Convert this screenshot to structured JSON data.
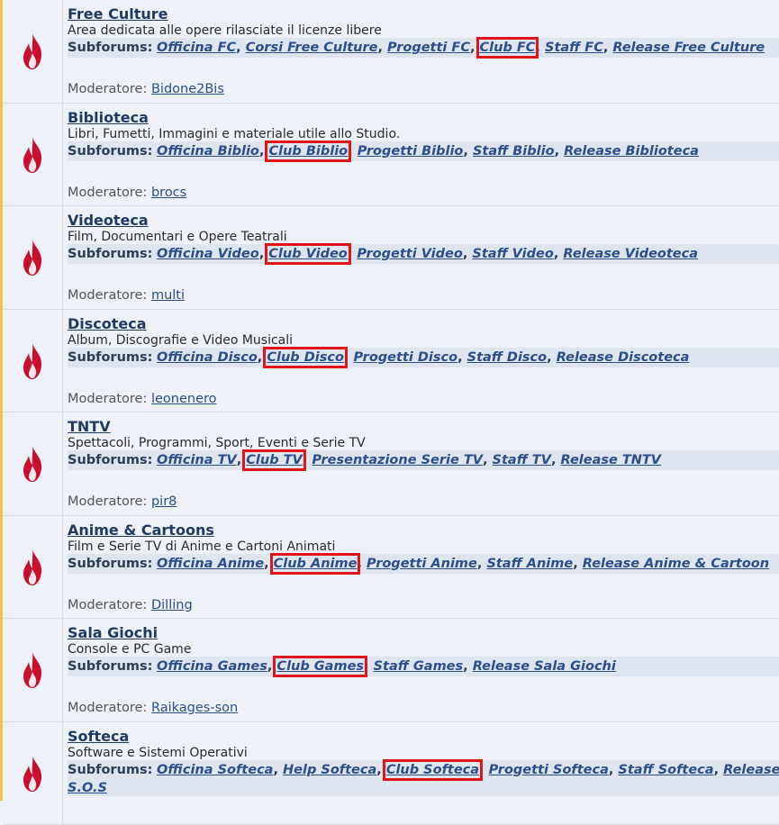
{
  "forums": [
    {
      "title": "Free Culture",
      "description": "Area dedicata alle opere rilasciate il licenze libere",
      "subforums_label": "Subforums:",
      "subforums": [
        "Officina FC",
        "Corsi Free Culture",
        "Progetti FC",
        "Club FC",
        "Staff FC",
        "Release Free Culture"
      ],
      "highlighted": "Club FC",
      "moderator_label": "Moderatore:",
      "moderator": "Bidone2Bis"
    },
    {
      "title": "Biblioteca",
      "description": "Libri, Fumetti, Immagini e materiale utile allo Studio.",
      "subforums_label": "Subforums:",
      "subforums": [
        "Officina Biblio",
        "Club Biblio",
        "Progetti Biblio",
        "Staff Biblio",
        "Release Biblioteca"
      ],
      "highlighted": "Club Biblio",
      "moderator_label": "Moderatore:",
      "moderator": "brocs"
    },
    {
      "title": "Videoteca",
      "description": "Film, Documentari e Opere Teatrali",
      "subforums_label": "Subforums:",
      "subforums": [
        "Officina Video",
        "Club Video",
        "Progetti Video",
        "Staff Video",
        "Release Videoteca"
      ],
      "highlighted": "Club Video",
      "moderator_label": "Moderatore:",
      "moderator": "multi"
    },
    {
      "title": "Discoteca",
      "description": "Album, Discografie e Video Musicali",
      "subforums_label": "Subforums:",
      "subforums": [
        "Officina Disco",
        "Club Disco",
        "Progetti Disco",
        "Staff Disco",
        "Release Discoteca"
      ],
      "highlighted": "Club Disco",
      "moderator_label": "Moderatore:",
      "moderator": "leonenero"
    },
    {
      "title": "TNTV",
      "description": "Spettacoli, Programmi, Sport, Eventi e Serie TV",
      "subforums_label": "Subforums:",
      "subforums": [
        "Officina TV",
        "Club TV",
        "Presentazione Serie TV",
        "Staff TV",
        "Release TNTV"
      ],
      "highlighted": "Club TV",
      "moderator_label": "Moderatore:",
      "moderator": "pir8"
    },
    {
      "title": "Anime & Cartoons",
      "description": "Film e Serie TV di Anime e Cartoni Animati",
      "subforums_label": "Subforums:",
      "subforums": [
        "Officina Anime",
        "Club Anime",
        "Progetti Anime",
        "Staff Anime",
        "Release Anime & Cartoon"
      ],
      "highlighted": "Club Anime",
      "moderator_label": "Moderatore:",
      "moderator": "Dilling"
    },
    {
      "title": "Sala Giochi",
      "description": "Console e PC Game",
      "subforums_label": "Subforums:",
      "subforums": [
        "Officina Games",
        "Club Games",
        "Staff Games",
        "Release Sala Giochi"
      ],
      "highlighted": "Club Games",
      "moderator_label": "Moderatore:",
      "moderator": "Raikages-son"
    },
    {
      "title": "Softeca",
      "description": "Software e Sistemi Operativi",
      "subforums_label": "Subforums:",
      "subforums": [
        "Officina Softeca",
        "Help Softeca",
        "Club Softeca",
        "Progetti Softeca",
        "Staff Softeca",
        "Release"
      ],
      "extra_line": "S.O.S",
      "highlighted": "Club Softeca",
      "moderator_label": "",
      "moderator": ""
    }
  ],
  "icon": "flame-icon",
  "colors": {
    "highlight": "#e0151b",
    "flame": "#c8102e",
    "link": "#2b4f8a",
    "title": "#1f3b63"
  }
}
